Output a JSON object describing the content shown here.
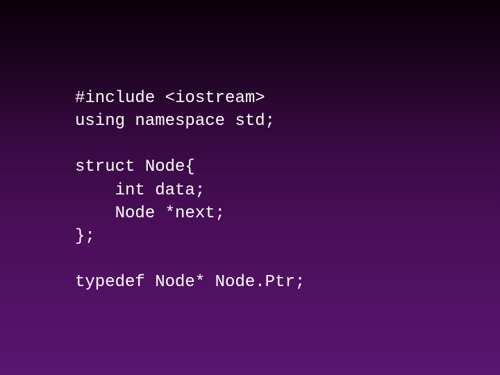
{
  "code": {
    "line1": "#include <iostream>",
    "line2": "using namespace std;",
    "line3": "",
    "line4": "struct Node{",
    "line5": "    int data;",
    "line6": "    Node *next;",
    "line7": "};",
    "line8": "",
    "line9": "typedef Node* Node.Ptr;"
  }
}
